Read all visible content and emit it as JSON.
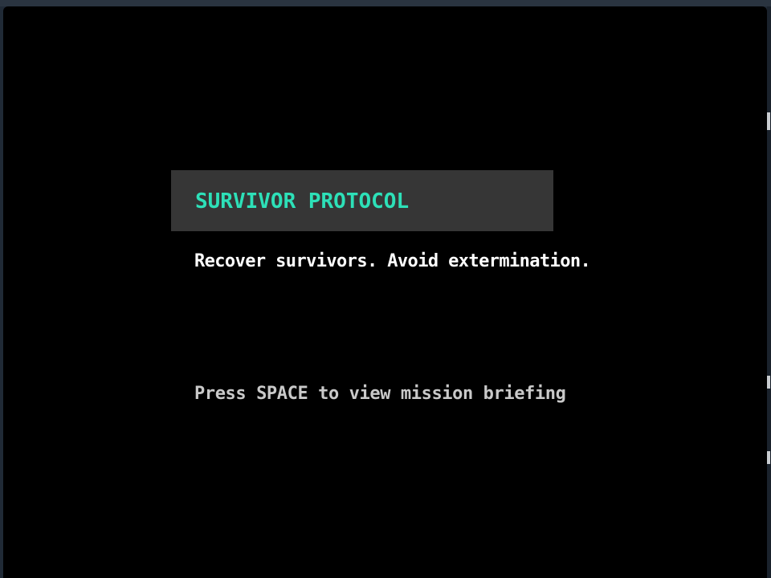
{
  "game": {
    "title": "SURVIVOR PROTOCOL",
    "tagline": "Recover survivors. Avoid extermination.",
    "prompt": "Press SPACE to view mission briefing"
  },
  "colors": {
    "title_accent": "#2de0b8",
    "banner_background": "#363636",
    "screen_background": "#000000",
    "tagline_text": "#ffffff",
    "prompt_text": "#c9c9c9"
  }
}
